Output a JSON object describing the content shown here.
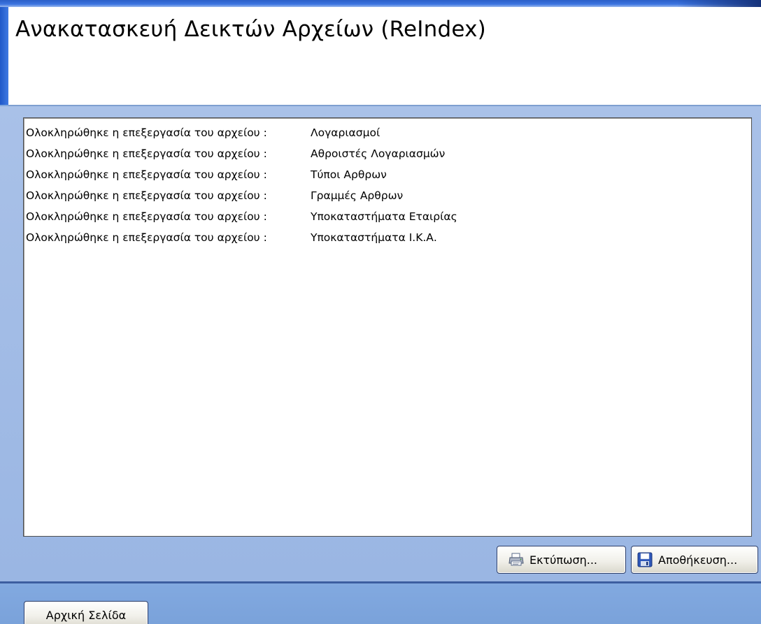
{
  "header": {
    "title": "Ανακατασκευή Δεικτών Αρχείων (ReIndex)"
  },
  "log": {
    "entries": [
      {
        "prefix": "Ολοκληρώθηκε η επεξεργασία του αρχείου :",
        "file": "Λογαριασμοί"
      },
      {
        "prefix": "Ολοκληρώθηκε η επεξεργασία του αρχείου :",
        "file": "Αθροιστές Λογαριασμών"
      },
      {
        "prefix": "Ολοκληρώθηκε η επεξεργασία του αρχείου :",
        "file": "Τύποι Αρθρων"
      },
      {
        "prefix": "Ολοκληρώθηκε η επεξεργασία του αρχείου :",
        "file": "Γραμμές Αρθρων"
      },
      {
        "prefix": "Ολοκληρώθηκε η επεξεργασία του αρχείου :",
        "file": "Υποκαταστήματα Εταιρίας"
      },
      {
        "prefix": "Ολοκληρώθηκε η επεξεργασία του αρχείου :",
        "file": "Υποκαταστήματα Ι.Κ.Α."
      }
    ]
  },
  "actions": {
    "print_label": "Εκτύπωση...",
    "save_label": "Αποθήκευση..."
  },
  "footer": {
    "home_label": "Αρχική Σελίδα"
  },
  "icons": {
    "print": "printer-icon",
    "save": "floppy-disk-icon"
  },
  "colors": {
    "window_blue": "#7fa6dc",
    "title_bar_blue": "#2b5fc8",
    "panel_blue": "#a9c1e8"
  }
}
